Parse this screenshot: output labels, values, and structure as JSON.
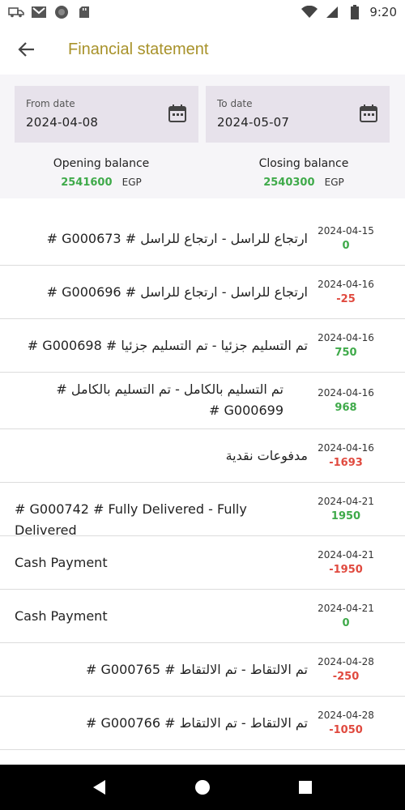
{
  "status_bar": {
    "time": "9:20",
    "left_icons": [
      "truck-icon",
      "gmail-icon",
      "circle-icon",
      "sd-card-icon"
    ],
    "right_icons": [
      "wifi-icon",
      "signal-icon",
      "battery-icon"
    ]
  },
  "header": {
    "title": "Financial statement",
    "back_icon": "arrow-left-icon",
    "accent_color": "#a8922a"
  },
  "filters": {
    "from_label": "From date",
    "from_value": "2024-04-08",
    "to_label": "To date",
    "to_value": "2024-05-07",
    "calendar_icon": "calendar-icon"
  },
  "balances": {
    "opening_label": "Opening balance",
    "opening_amount": "2541600",
    "closing_label": "Closing balance",
    "closing_amount": "2540300",
    "currency": "EGP",
    "positive_color": "#3faa4a",
    "negative_color": "#e04a3f"
  },
  "transactions": [
    {
      "description": "ارتجاع للراسل - ارتجاع للراسل # G000673 #",
      "date": "2024-04-15",
      "amount": "0",
      "sign": "pos"
    },
    {
      "description": "ارتجاع للراسل - ارتجاع للراسل # G000696 #",
      "date": "2024-04-16",
      "amount": "-25",
      "sign": "neg"
    },
    {
      "description": "تم التسليم جزئيا - تم التسليم جزئيا # G000698 #",
      "date": "2024-04-16",
      "amount": "750",
      "sign": "pos"
    },
    {
      "description": "تم التسليم بالكامل - تم التسليم بالكامل # G000699 #",
      "date": "2024-04-16",
      "amount": "968",
      "sign": "pos"
    },
    {
      "description": "مدفوعات نقدية",
      "date": "2024-04-16",
      "amount": "-1693",
      "sign": "neg"
    },
    {
      "description": "# G000742 # Fully Delivered - Fully Delivered",
      "date": "2024-04-21",
      "amount": "1950",
      "sign": "pos"
    },
    {
      "description": "Cash Payment",
      "date": "2024-04-21",
      "amount": "-1950",
      "sign": "neg"
    },
    {
      "description": "Cash Payment",
      "date": "2024-04-21",
      "amount": "0",
      "sign": "pos"
    },
    {
      "description": "تم الالتقاط - تم الالتقاط # G000765 #",
      "date": "2024-04-28",
      "amount": "-250",
      "sign": "neg"
    },
    {
      "description": "تم الالتقاط - تم الالتقاط # G000766 #",
      "date": "2024-04-28",
      "amount": "-1050",
      "sign": "neg"
    }
  ],
  "nav_bar": {
    "icons": [
      "back-triangle-icon",
      "home-circle-icon",
      "recents-square-icon"
    ]
  }
}
